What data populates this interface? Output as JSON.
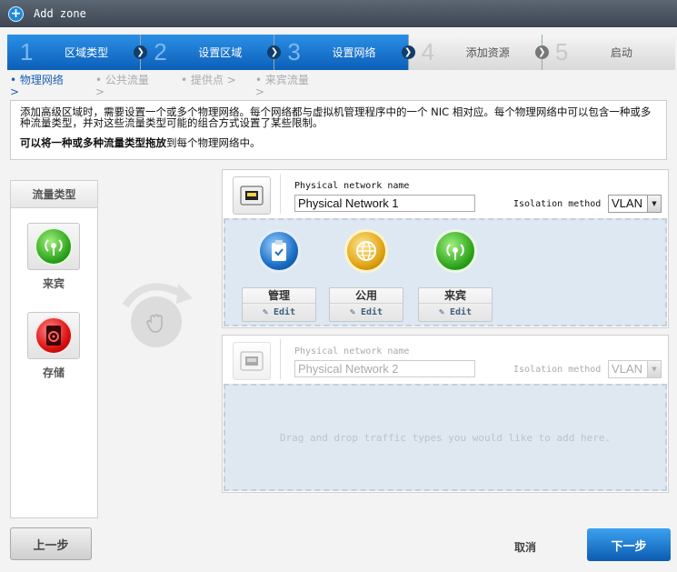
{
  "window": {
    "title": "Add zone"
  },
  "steps": [
    {
      "num": "1",
      "label": "区域类型",
      "state": "done"
    },
    {
      "num": "2",
      "label": "设置区域",
      "state": "done"
    },
    {
      "num": "3",
      "label": "设置网络",
      "state": "done"
    },
    {
      "num": "4",
      "label": "添加资源",
      "state": "todo"
    },
    {
      "num": "5",
      "label": "启动",
      "state": "todo"
    }
  ],
  "subnav": [
    {
      "label": "• 物理网络 >",
      "active": true
    },
    {
      "label": "• 公共流量 >",
      "active": false
    },
    {
      "label": "• 提供点 >",
      "active": false
    },
    {
      "label": "• 来宾流量 >",
      "active": false
    }
  ],
  "description": {
    "line1": "添加高级区域时，需要设置一个或多个物理网络。每个网络都与虚拟机管理程序中的一个 NIC 相对应。每个物理网络中可以包含一种或多种流量类型，并对这些流量类型可能的组合方式设置了某些限制。",
    "line2_bold": "可以将一种或多种流量类型拖放",
    "line2_rest": "到每个物理网络中。"
  },
  "traffic_panel": {
    "title": "流量类型",
    "items": [
      {
        "label": "来宾",
        "icon": "guest-traffic-icon"
      },
      {
        "label": "存储",
        "icon": "storage-traffic-icon"
      }
    ]
  },
  "networks": [
    {
      "name_label": "Physical network name",
      "name_value": "Physical Network 1",
      "isolation_label": "Isolation method",
      "isolation_value": "VLAN",
      "traffic": [
        {
          "label": "管理",
          "edit": "Edit",
          "icon": "management-traffic-icon"
        },
        {
          "label": "公用",
          "edit": "Edit",
          "icon": "public-traffic-icon"
        },
        {
          "label": "来宾",
          "edit": "Edit",
          "icon": "guest-traffic-icon"
        }
      ]
    },
    {
      "name_label": "Physical network name",
      "name_value": "Physical Network 2",
      "isolation_label": "Isolation method",
      "isolation_value": "VLAN",
      "drop_hint": "Drag and drop traffic types you would like to add here."
    }
  ],
  "footer": {
    "back_label": "上一步",
    "cancel_label": "取消",
    "next_label": "下一步"
  },
  "colors": {
    "accent": "#1a73d0",
    "title_bar": "#48525e",
    "drop_zone": "#dde8f2"
  }
}
